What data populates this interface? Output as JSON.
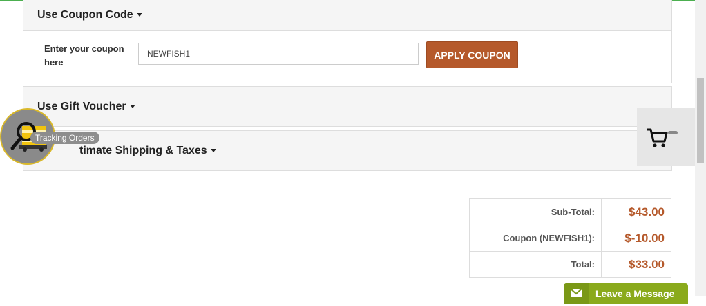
{
  "coupon": {
    "title": "Use Coupon Code",
    "label": "Enter your coupon here",
    "input_value": "NEWFISH1",
    "apply_label": "APPLY COUPON"
  },
  "gift_voucher": {
    "title": "Use Gift Voucher"
  },
  "shipping": {
    "title_visible": "timate Shipping & Taxes"
  },
  "totals": [
    {
      "label": "Sub-Total:",
      "value": "$43.00"
    },
    {
      "label": "Coupon (NEWFISH1):",
      "value": "$-10.00"
    },
    {
      "label": "Total:",
      "value": "$33.00"
    }
  ],
  "tracking": {
    "label": "Tracking Orders",
    "icon": "magnifier-truck-icon"
  },
  "cart_widget": {
    "icon": "cart-icon",
    "count": "-"
  },
  "leave_message": {
    "label": "Leave a Message",
    "icon": "envelope-icon"
  },
  "colors": {
    "accent": "#b5592b",
    "top_line": "#4caf50",
    "chat_green": "#8aaa1c"
  }
}
